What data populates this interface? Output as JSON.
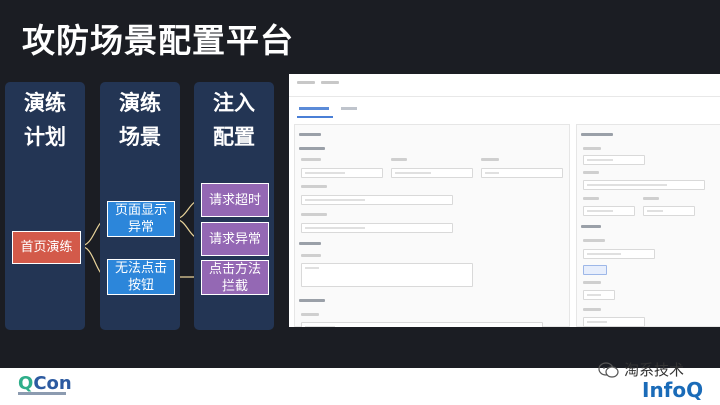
{
  "title": "攻防场景配置平台",
  "columns": {
    "plan": "演练\n计划",
    "scene": "演练\n场景",
    "inject": "注入\n配置"
  },
  "nodes": {
    "homepage": "首页演练",
    "display_error": "页面显示\n异常",
    "cannot_click": "无法点击\n按钮",
    "timeout": "请求超时",
    "request_error": "请求异常",
    "intercept": "点击方法\n拦截"
  },
  "logos": {
    "qcon": "QCon",
    "wechat": "淘系技术",
    "infoq": "InfoQ"
  },
  "colors": {
    "background": "#1b1d23",
    "column": "#233554",
    "red": "#d35a4a",
    "blue": "#2c86da",
    "purple": "#9468b4"
  }
}
